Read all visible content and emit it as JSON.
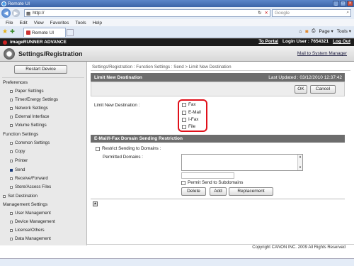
{
  "browser": {
    "window_title": "Remote UI",
    "address": "http://",
    "search_placeholder": "Google",
    "menu": [
      "File",
      "Edit",
      "View",
      "Favorites",
      "Tools",
      "Help"
    ],
    "tab_title": "Remote UI",
    "commands": {
      "page": "Page ▾",
      "tools": "Tools ▾"
    }
  },
  "app": {
    "product": "imageRUNNER ADVANCE",
    "to_portal": "To Portal",
    "login_user": "Login User : 7654321",
    "logout": "Log Out",
    "title": "Settings/Registration",
    "mail_to_admin": "Mail to System Manager"
  },
  "sidebar": {
    "restart": "Restart Device",
    "preferences": "Preferences",
    "pref_items": [
      "Paper Settings",
      "Timer/Energy Settings",
      "Network Settings",
      "External Interface",
      "Volume Settings"
    ],
    "function_settings": "Function Settings",
    "func_items": [
      "Common Settings",
      "Copy",
      "Printer",
      "Send",
      "Receive/Forward",
      "Store/Access Files"
    ],
    "set_destination": "Set Destination",
    "management_settings": "Management Settings",
    "mgmt_items": [
      "User Management",
      "Device Management",
      "License/Others",
      "Data Management"
    ]
  },
  "main": {
    "breadcrumb": "Settings/Registration : Function Settings : Send > Limit New Destination",
    "panel_title": "Limit New Destination",
    "last_updated": "Last Updated : 03/12/2010 12:37:42",
    "ok": "OK",
    "cancel": "Cancel",
    "limit_label": "Limit New Destination :",
    "limit_options": [
      "Fax",
      "E-Mail",
      "I-Fax",
      "File"
    ],
    "domain_section": "E-Mail/I-Fax Domain Sending Restriction",
    "restrict_label": "Restrict Sending to Domains :",
    "permitted_label": "Permitted Domains :",
    "permit_subdomains": "Permit Send to Subdomains",
    "delete": "Delete",
    "add": "Add",
    "replacement": "Replacement"
  },
  "footer": {
    "copyright": "Copyright CANON INC. 2009 All Rights Reserved"
  },
  "colors": {
    "highlight": "#e0101a",
    "header_bg": "#1c1c1c",
    "panel_head": "#6d6d6d"
  }
}
